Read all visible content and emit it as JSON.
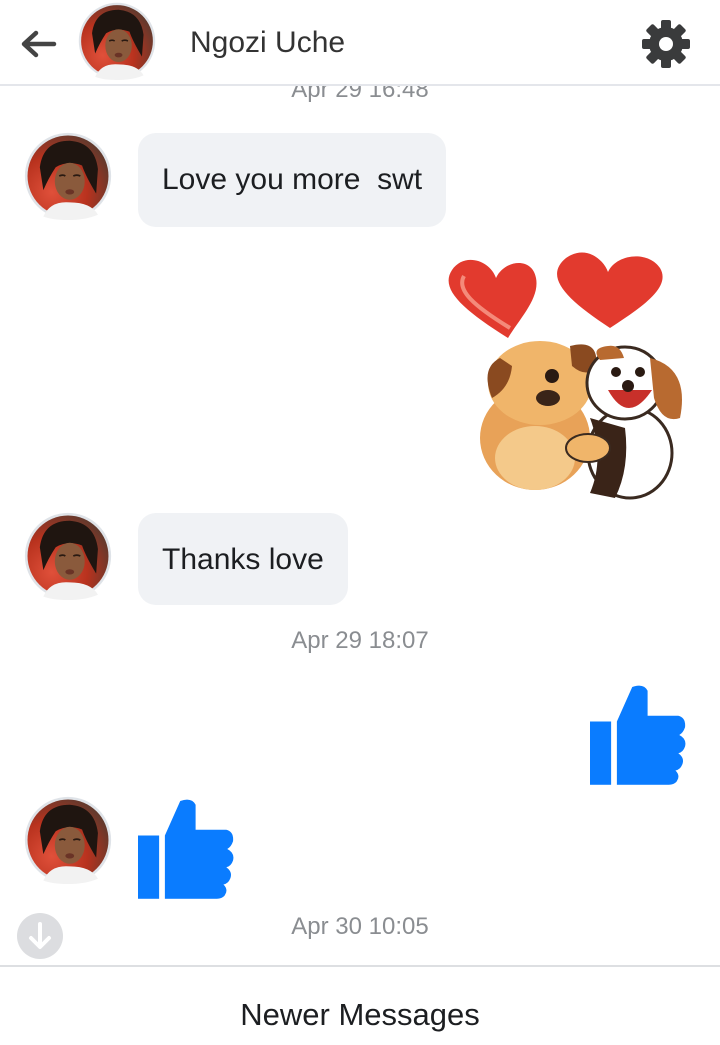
{
  "header": {
    "contact_name": "Ngozi Uche"
  },
  "icons": {
    "back": "back-arrow-icon",
    "settings": "gear-icon",
    "scroll_down": "arrow-down-icon",
    "like": "thumbs-up-icon"
  },
  "colors": {
    "messenger_blue": "#0a7cff",
    "bubble_bg": "#f0f2f5",
    "timestamp": "#8a8d91"
  },
  "messages": {
    "cut_timestamp": "Apr 29 16:48",
    "msg1": "Love you more  swt",
    "sticker": "two-dogs-hugging-with-hearts-sticker",
    "msg2": "Thanks love",
    "ts2": "Apr 29 18:07",
    "like_sent": "thumbs-up",
    "like_received": "thumbs-up",
    "ts3": "Apr 30 10:05"
  },
  "footer": {
    "newer_label": "Newer Messages"
  }
}
